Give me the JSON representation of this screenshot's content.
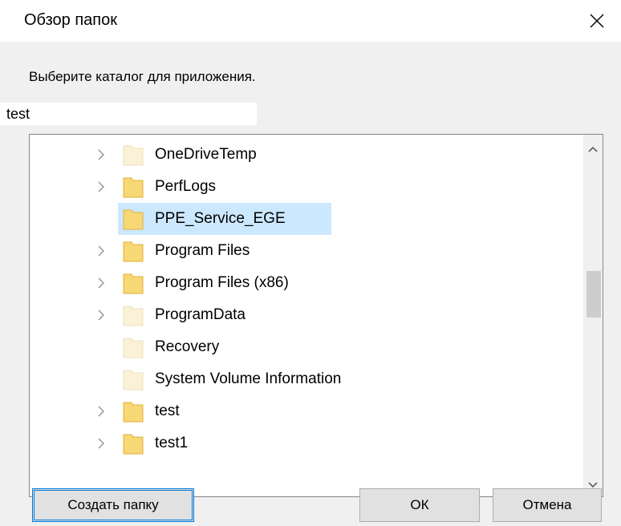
{
  "window": {
    "title": "Обзор папок"
  },
  "instruction": "Выберите каталог для приложения.",
  "path_field": {
    "value": "test"
  },
  "tree": {
    "items": [
      {
        "label": "OneDriveTemp",
        "expandable": true,
        "folder_style": "pale",
        "selected": false
      },
      {
        "label": "PerfLogs",
        "expandable": true,
        "folder_style": "yellow",
        "selected": false
      },
      {
        "label": "PPE_Service_EGE",
        "expandable": false,
        "folder_style": "yellow",
        "selected": true
      },
      {
        "label": "Program Files",
        "expandable": true,
        "folder_style": "yellow",
        "selected": false
      },
      {
        "label": "Program Files (x86)",
        "expandable": true,
        "folder_style": "yellow",
        "selected": false
      },
      {
        "label": "ProgramData",
        "expandable": true,
        "folder_style": "pale",
        "selected": false
      },
      {
        "label": "Recovery",
        "expandable": false,
        "folder_style": "pale",
        "selected": false
      },
      {
        "label": "System Volume Information",
        "expandable": false,
        "folder_style": "pale",
        "selected": false
      },
      {
        "label": "test",
        "expandable": true,
        "folder_style": "yellow",
        "selected": false
      },
      {
        "label": "test1",
        "expandable": true,
        "folder_style": "yellow",
        "selected": false
      }
    ]
  },
  "buttons": {
    "create_folder": "Создать папку",
    "ok": "ОК",
    "cancel": "Отмена"
  },
  "colors": {
    "selection": "#cce8ff",
    "folder_yellow": "#f8d775",
    "folder_pale": "#fbf1d6",
    "default_button_border": "#0078d7"
  }
}
